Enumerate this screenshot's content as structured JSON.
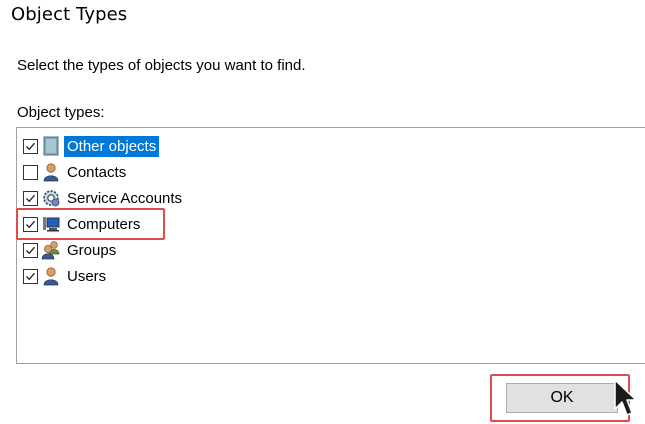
{
  "dialog": {
    "title": "Object Types",
    "instruction": "Select the types of objects you want to find.",
    "list_label": "Object types:"
  },
  "object_types": [
    {
      "label": "Other objects",
      "checked": true,
      "selected": true,
      "icon": "folder-icon"
    },
    {
      "label": "Contacts",
      "checked": false,
      "selected": false,
      "icon": "contact-icon"
    },
    {
      "label": "Service Accounts",
      "checked": true,
      "selected": false,
      "icon": "service-account-icon"
    },
    {
      "label": "Computers",
      "checked": true,
      "selected": false,
      "icon": "computer-icon"
    },
    {
      "label": "Groups",
      "checked": true,
      "selected": false,
      "icon": "group-icon"
    },
    {
      "label": "Users",
      "checked": true,
      "selected": false,
      "icon": "user-icon"
    }
  ],
  "buttons": {
    "ok_label": "OK"
  },
  "colors": {
    "selection": "#0078d7",
    "highlight_border": "#e04b4b"
  }
}
